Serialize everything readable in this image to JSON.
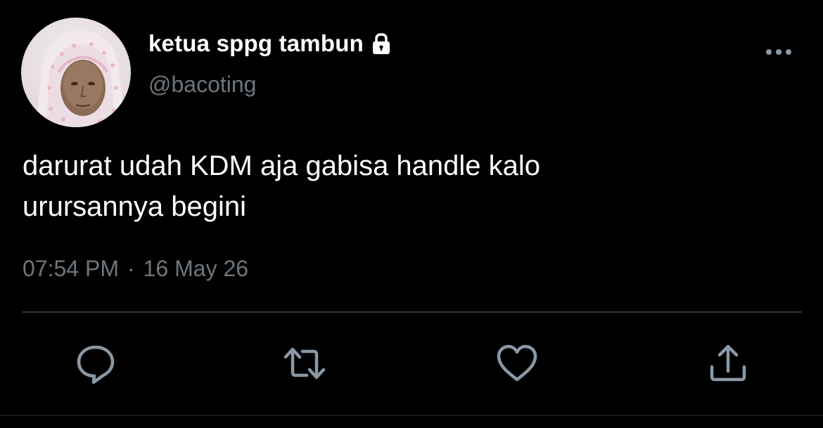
{
  "user": {
    "display_name": "ketua sppg tambun",
    "handle": "@bacoting",
    "protected_icon": "lock-icon",
    "avatar": "profile-photo"
  },
  "tweet": {
    "text_lines": [
      "darurat udah KDM aja gabisa handle kalo",
      "urursannya begini"
    ],
    "time": "07:54 PM",
    "separator": "·",
    "date": "16 May 26"
  },
  "actions": {
    "reply_icon": "reply-icon",
    "retweet_icon": "retweet-icon",
    "like_icon": "heart-icon",
    "share_icon": "share-icon",
    "more_icon": "more-options-icon"
  },
  "colors": {
    "background": "#000000",
    "primary_text": "#ffffff",
    "secondary_text": "#6e767d",
    "divider": "#2f3336",
    "icon": "#8b98a5"
  }
}
